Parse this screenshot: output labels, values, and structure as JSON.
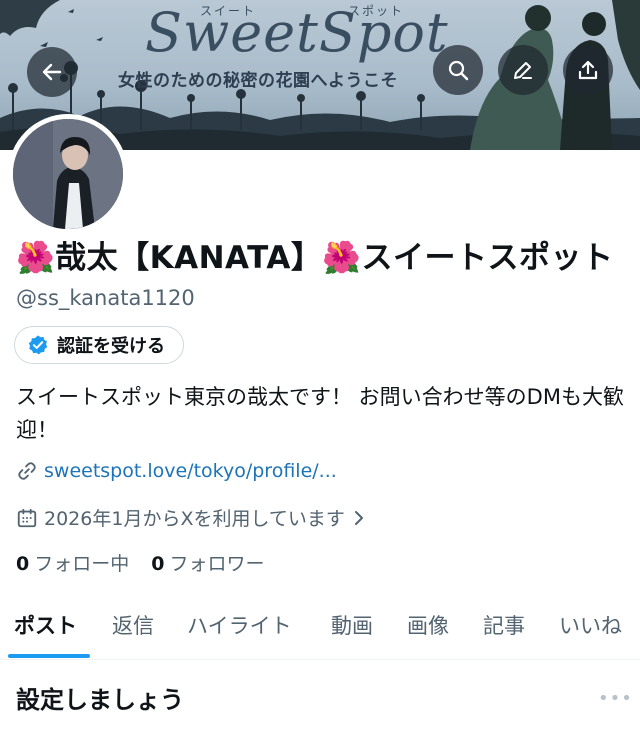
{
  "banner": {
    "ruby_left": "スイート",
    "ruby_right": "スポット",
    "brand": "SweetSpot",
    "tagline": "女性のための秘密の花園へようこそ"
  },
  "header_buttons": {
    "back": "arrow-left-icon",
    "search": "search-icon",
    "edit": "edit-icon",
    "share": "share-icon"
  },
  "profile": {
    "name": "🌺哉太【KANATA】🌺スイートスポット",
    "handle": "@ss_kanata1120",
    "verify_label": "認証を受ける",
    "bio": "スイートスポット東京の哉太です！ お問い合わせ等のDMも大歓迎！",
    "link": "sweetspot.love/tokyo/profile/...",
    "joined": "2026年1月からXを利用しています",
    "following_count": "0",
    "following_label": "フォロー中",
    "followers_count": "0",
    "followers_label": "フォロワー"
  },
  "tabs": [
    {
      "label": "ポスト",
      "active": true
    },
    {
      "label": "返信"
    },
    {
      "label": "ハイライト"
    },
    {
      "label": "動画"
    },
    {
      "label": "画像"
    },
    {
      "label": "記事"
    },
    {
      "label": "いいね"
    }
  ],
  "section": {
    "title": "設定しましょう",
    "more": "•••"
  },
  "colors": {
    "accent": "#1d9bf0",
    "text": "#0f1419",
    "secondary": "#536471",
    "banner_sky": "#a9bccb"
  }
}
